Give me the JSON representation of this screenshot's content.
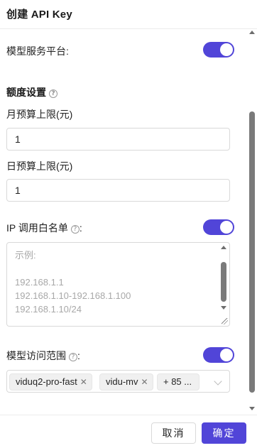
{
  "dialog": {
    "title": "创建 API Key"
  },
  "platform": {
    "label": "模型服务平台:",
    "enabled": true
  },
  "quota": {
    "section_title": "额度设置",
    "help_icon": "question-circle-icon",
    "monthly_label": "月预算上限(元)",
    "monthly_value": "1",
    "daily_label": "日预算上限(元)",
    "daily_value": "1"
  },
  "ip_whitelist": {
    "label": "IP 调用白名单",
    "suffix": ":",
    "enabled": true,
    "placeholder": "示例:\n\n192.168.1.1\n192.168.1.10-192.168.1.100\n192.168.1.10/24"
  },
  "model_scope": {
    "label": "模型访问范围",
    "suffix": ":",
    "enabled": true,
    "tags": [
      "viduq2-pro-fast",
      "vidu-mv"
    ],
    "more_tag": "+ 85 ..."
  },
  "footer": {
    "cancel_label": "取消",
    "ok_label": "确定"
  },
  "colors": {
    "accent": "#5145d8",
    "border": "#d9d9d9",
    "placeholder": "#a8a8a8"
  }
}
